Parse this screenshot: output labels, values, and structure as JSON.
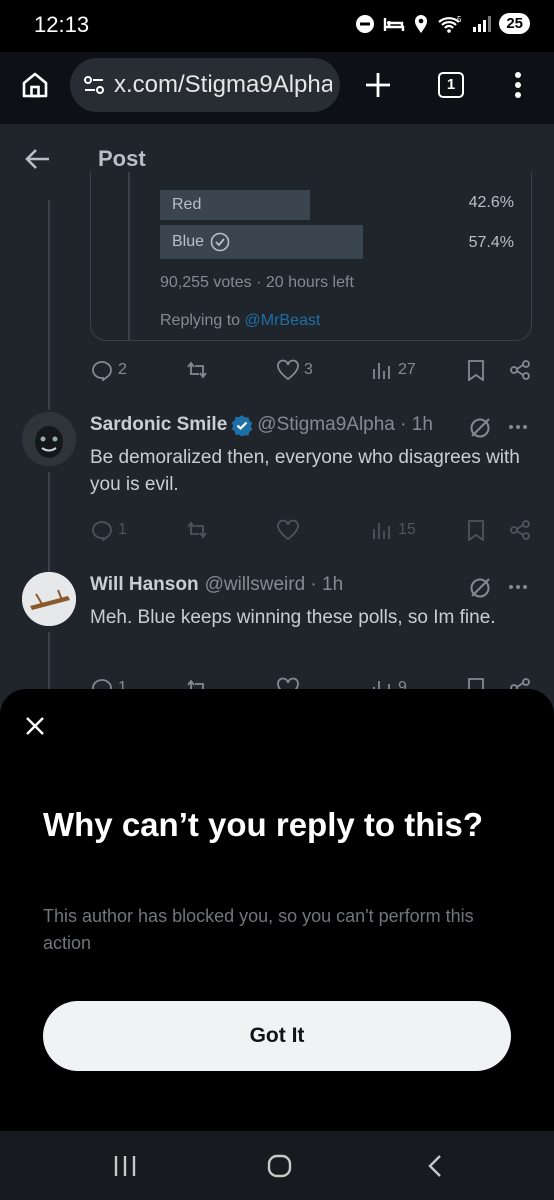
{
  "status_bar": {
    "time": "12:13",
    "battery": "25"
  },
  "browser": {
    "url": "x.com/Stigma9Alpha",
    "tab_count": "1"
  },
  "post_header": {
    "title": "Post"
  },
  "poll": {
    "options": [
      {
        "label": "Red",
        "percent": "42.6%",
        "share": 0.426
      },
      {
        "label": "Blue",
        "percent": "57.4%",
        "share": 0.574,
        "winner": true
      }
    ],
    "meta": "90,255 votes · 20 hours left",
    "replying_prefix": "Replying to ",
    "replying_handle": "@MrBeast"
  },
  "quoted_post_actions": {
    "replies": "2",
    "likes": "3",
    "views": "27"
  },
  "replies": [
    {
      "name": "Sardonic Smile",
      "handle": "@Stigma9Alpha · 1h",
      "verified": true,
      "text": "Be demoralized then, everyone who disagrees with you is evil.",
      "replies": "1",
      "views": "15"
    },
    {
      "name": "Will Hanson",
      "handle": "@willsweird · 1h",
      "verified": false,
      "text": "Meh.  Blue keeps winning these polls, so Im fine.",
      "replies": "1",
      "views": "9"
    }
  ],
  "sheet": {
    "title": "Why can’t you reply to this?",
    "body": "This author has blocked you, so you can't perform this action",
    "button": "Got It"
  },
  "colors": {
    "accent": "#1d9bf0",
    "sheet_bg": "#000000",
    "button_bg": "#eff3f4"
  }
}
